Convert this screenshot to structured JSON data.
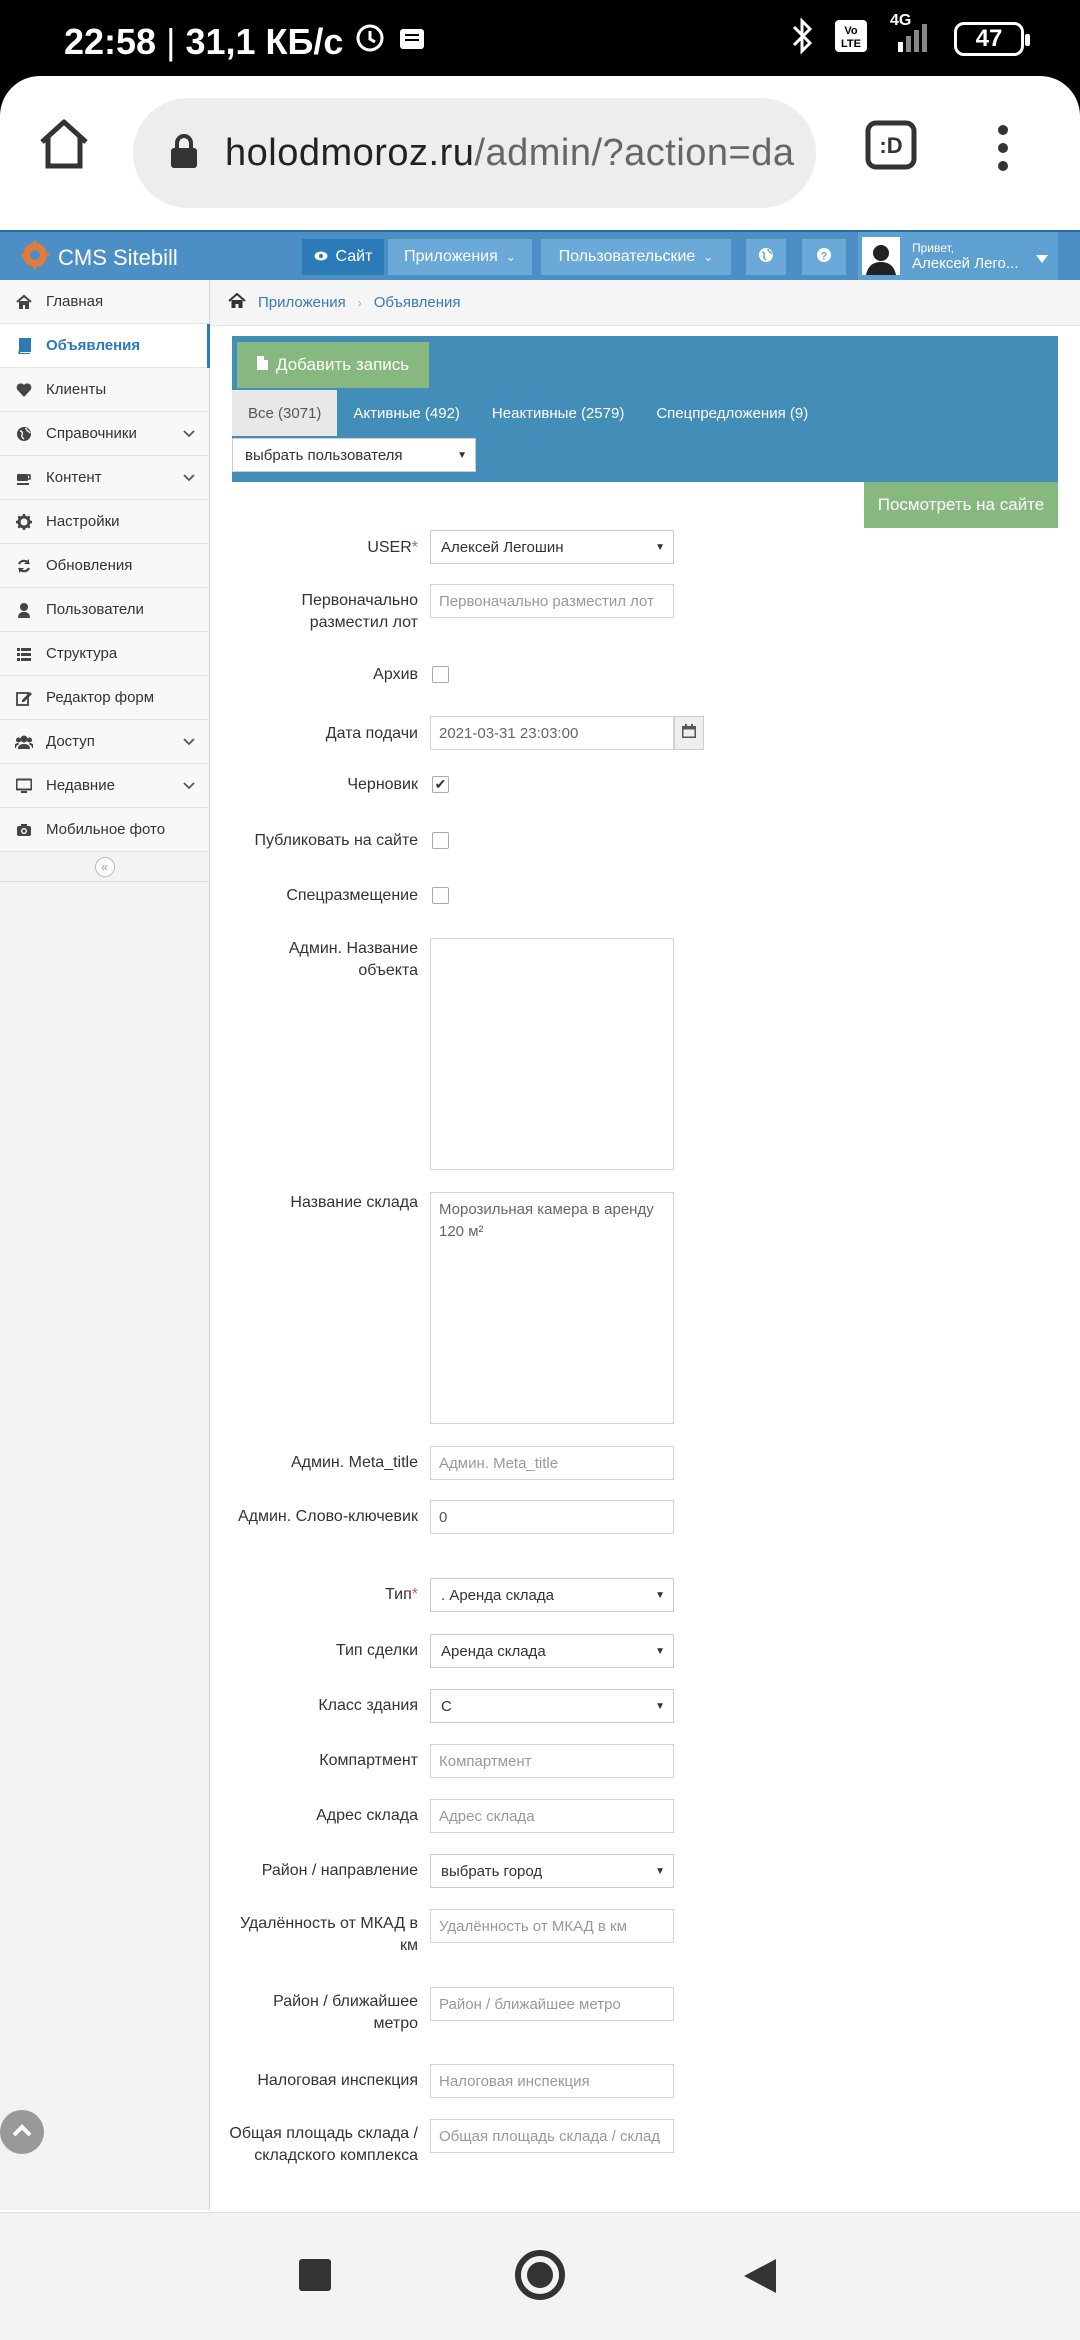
{
  "status_bar": {
    "time": "22:58",
    "speed": "31,1 КБ/с",
    "network": "4G",
    "battery": "47"
  },
  "browser": {
    "url_domain": "holodmoroz.ru",
    "url_path": "/admin/?action=da",
    "tab_badge": ":D"
  },
  "header": {
    "brand": "CMS Sitebill",
    "site_btn": "Сайт",
    "apps_btn": "Приложения",
    "custom_btn": "Пользовательские",
    "greeting": "Привет,",
    "username": "Алексей Лего..."
  },
  "sidebar": {
    "items": [
      {
        "label": "Главная",
        "icon": "home-icon"
      },
      {
        "label": "Объявления",
        "icon": "book-icon"
      },
      {
        "label": "Клиенты",
        "icon": "heart-icon"
      },
      {
        "label": "Справочники",
        "icon": "globe-icon"
      },
      {
        "label": "Контент",
        "icon": "coffee-icon"
      },
      {
        "label": "Настройки",
        "icon": "gear-icon"
      },
      {
        "label": "Обновления",
        "icon": "refresh-icon"
      },
      {
        "label": "Пользователи",
        "icon": "user-icon"
      },
      {
        "label": "Структура",
        "icon": "list-icon"
      },
      {
        "label": "Редактор форм",
        "icon": "edit-icon"
      },
      {
        "label": "Доступ",
        "icon": "users-icon"
      },
      {
        "label": "Недавние",
        "icon": "desktop-icon"
      },
      {
        "label": "Мобильное фото",
        "icon": "camera-icon"
      }
    ],
    "collapse": "«"
  },
  "breadcrumb": {
    "apps": "Приложения",
    "ads": "Объявления"
  },
  "panel": {
    "add_btn": "Добавить запись",
    "tabs": [
      "Все (3071)",
      "Активные (492)",
      "Неактивные (2579)",
      "Спецпредложения (9)"
    ],
    "user_select": "выбрать пользователя",
    "view_btn": "Посмотреть на сайте"
  },
  "form": {
    "user_label": "USER",
    "user_value": "Алексей Легошин",
    "first_label": "Первоначально разместил лот",
    "first_ph": "Первоначально разместил лот",
    "archive_label": "Архив",
    "date_label": "Дата подачи",
    "date_value": "2021-03-31 23:03:00",
    "draft_label": "Черновик",
    "draft_check": "✔",
    "publish_label": "Публиковать на сайте",
    "special_label": "Спецразмещение",
    "admin_name_label": "Админ. Название объекта",
    "warehouse_label": "Название склада",
    "warehouse_value": "Морозильная камера в аренду 120 м²",
    "meta_label": "Админ. Meta_title",
    "meta_ph": "Админ. Meta_title",
    "keyword_label": "Админ. Слово-ключевик",
    "keyword_value": "0",
    "type_label": "Тип",
    "type_value": ". Аренда склада",
    "deal_label": "Тип сделки",
    "deal_value": "Аренда склада",
    "class_label": "Класс здания",
    "class_value": "C",
    "comp_label": "Компартмент",
    "comp_ph": "Компартмент",
    "address_label": "Адрес склада",
    "address_ph": "Адрес склада",
    "district_label": "Район / направление",
    "district_value": "выбрать город",
    "mkad_label": "Удалённость от МКАД в км",
    "mkad_ph": "Удалённость от МКАД в км",
    "metro_label": "Район / ближайшее метро",
    "metro_ph": "Район / ближайшее метро",
    "tax_label": "Налоговая инспекция",
    "tax_ph": "Налоговая инспекция",
    "area_label": "Общая площадь склада / складского комплекса",
    "area_ph": "Общая площадь склада / склад"
  }
}
